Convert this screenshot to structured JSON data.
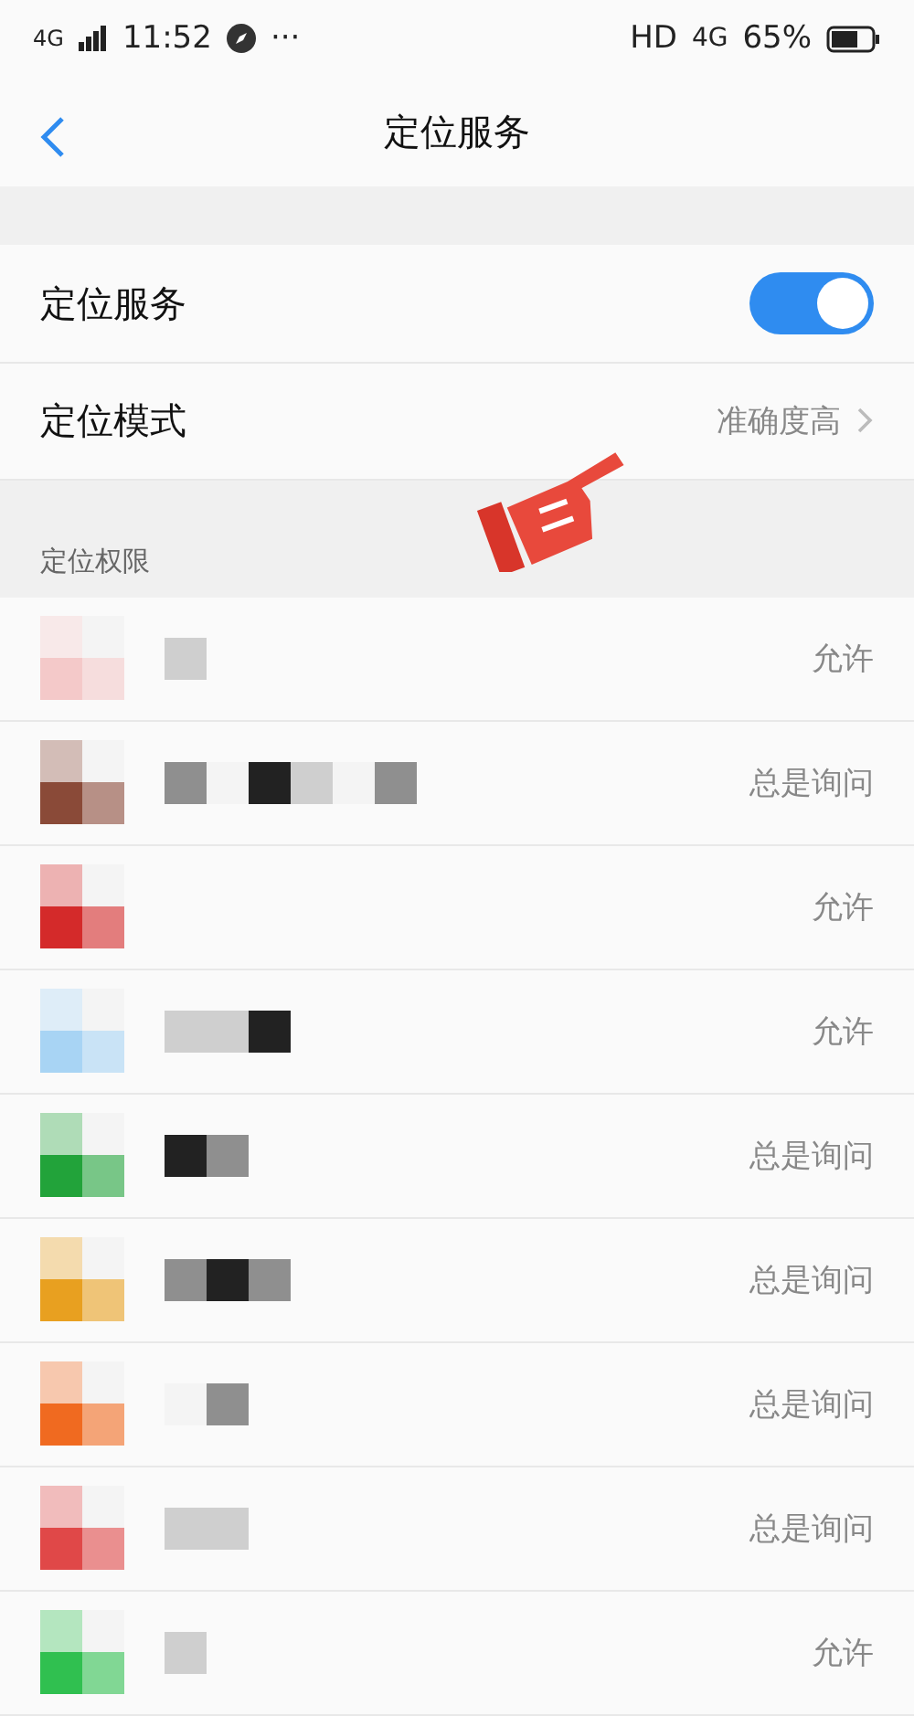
{
  "status_bar": {
    "network": "4G",
    "time": "11:52",
    "more": "···",
    "hd": "HD",
    "network_right": "4G",
    "battery": "65%"
  },
  "header": {
    "title": "定位服务"
  },
  "settings": [
    {
      "label": "定位服务",
      "kind": "switch",
      "on": true
    },
    {
      "label": "定位模式",
      "kind": "link",
      "value": "准确度高"
    }
  ],
  "section": {
    "title": "定位权限"
  },
  "apps": [
    {
      "color": "#f4c9c9",
      "permission": "允许"
    },
    {
      "color": "#8a4a38",
      "permission": "总是询问"
    },
    {
      "color": "#d42a2a",
      "permission": "允许"
    },
    {
      "color": "#a8d4f4",
      "permission": "允许"
    },
    {
      "color": "#22a33a",
      "permission": "总是询问"
    },
    {
      "color": "#e8a020",
      "permission": "总是询问"
    },
    {
      "color": "#f06a20",
      "permission": "总是询问"
    },
    {
      "color": "#e04848",
      "permission": "总是询问"
    },
    {
      "color": "#30c050",
      "permission": "允许"
    }
  ]
}
